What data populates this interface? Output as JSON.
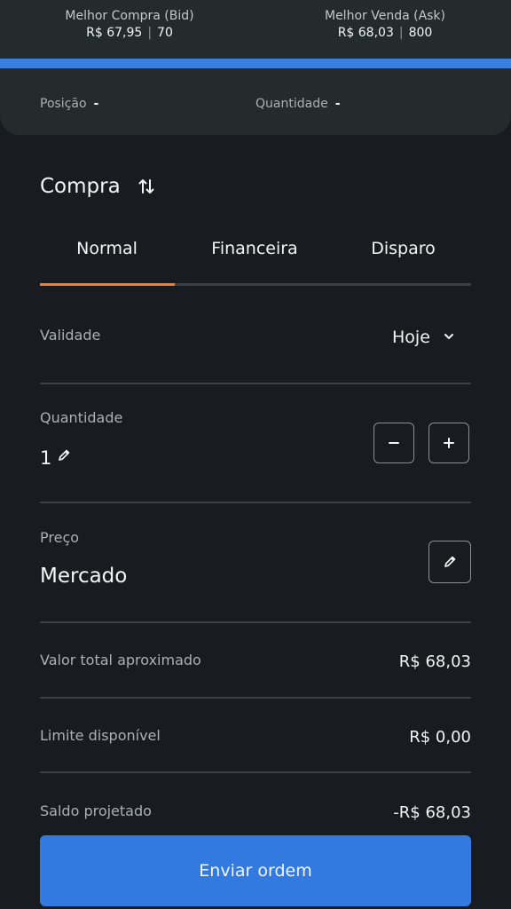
{
  "market": {
    "bid_label": "Melhor Compra (Bid)",
    "bid_price": "R$ 67,95",
    "bid_qty": "70",
    "ask_label": "Melhor Venda (Ask)",
    "ask_price": "R$ 68,03",
    "ask_qty": "800",
    "separator": "|"
  },
  "position": {
    "position_label": "Posição",
    "position_value": "-",
    "quantity_label": "Quantidade",
    "quantity_value": "-"
  },
  "order": {
    "side": "Compra",
    "tabs": [
      {
        "label": "Normal",
        "active": true
      },
      {
        "label": "Financeira",
        "active": false
      },
      {
        "label": "Disparo",
        "active": false
      }
    ],
    "validity_label": "Validade",
    "validity_value": "Hoje",
    "quantity_label": "Quantidade",
    "quantity_value": "1",
    "price_label": "Preço",
    "price_value": "Mercado"
  },
  "summary": [
    {
      "label": "Valor total aproximado",
      "value": "R$ 68,03"
    },
    {
      "label": "Limite disponível",
      "value": "R$ 0,00"
    },
    {
      "label": "Saldo projetado",
      "value": "-R$ 68,03"
    }
  ],
  "submit_label": "Enviar ordem",
  "colors": {
    "accent": "#3279e0",
    "tab_indicator": "#e8813a",
    "background": "#181c20",
    "card": "#242b2d"
  }
}
